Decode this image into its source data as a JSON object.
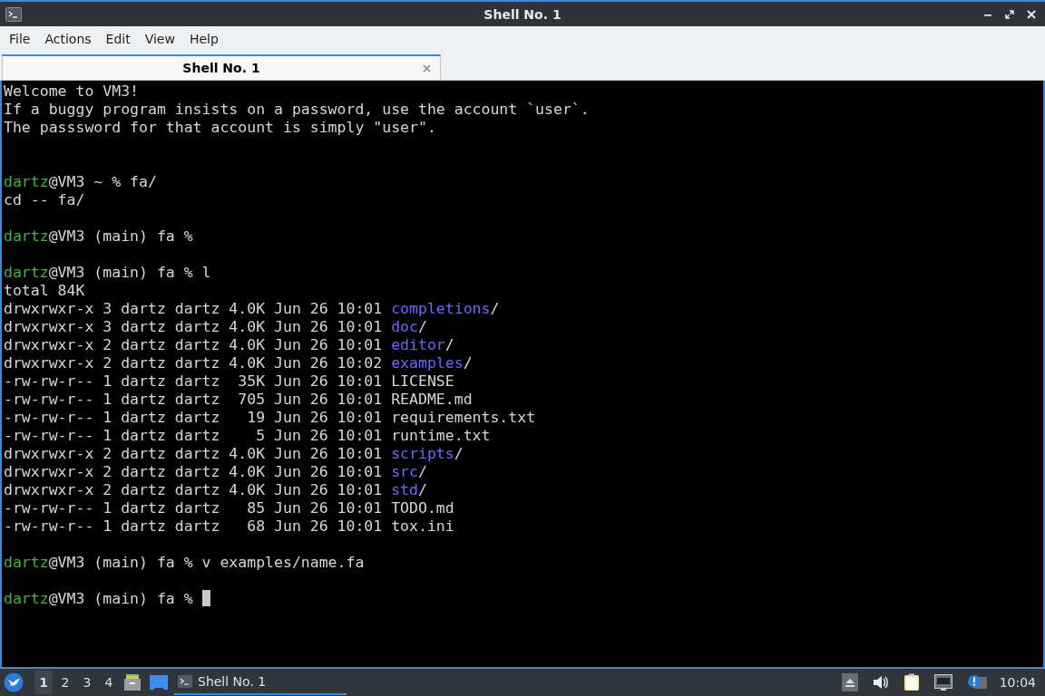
{
  "window": {
    "title": "Shell No. 1"
  },
  "menu": [
    "File",
    "Actions",
    "Edit",
    "View",
    "Help"
  ],
  "tabs": [
    {
      "label": "Shell No. 1",
      "selected": true
    }
  ],
  "terminal": {
    "lines": [
      {
        "segments": [
          {
            "kind": "plain",
            "text": "Welcome to VM3!"
          }
        ]
      },
      {
        "segments": [
          {
            "kind": "plain",
            "text": "If a buggy program insists on a password, use the account `user`."
          }
        ]
      },
      {
        "segments": [
          {
            "kind": "plain",
            "text": "The passsword for that account is simply \"user\"."
          }
        ]
      },
      {
        "kind": "blank"
      },
      {
        "kind": "blank"
      },
      {
        "segments": [
          {
            "kind": "user",
            "text": "dartz"
          },
          {
            "kind": "plain",
            "text": "@VM3 ~ % fa/"
          }
        ]
      },
      {
        "segments": [
          {
            "kind": "plain",
            "text": "cd -- fa/"
          }
        ]
      },
      {
        "kind": "blank"
      },
      {
        "segments": [
          {
            "kind": "user",
            "text": "dartz"
          },
          {
            "kind": "plain",
            "text": "@VM3 (main) fa %"
          }
        ]
      },
      {
        "kind": "blank"
      },
      {
        "segments": [
          {
            "kind": "user",
            "text": "dartz"
          },
          {
            "kind": "plain",
            "text": "@VM3 (main) fa % l"
          }
        ]
      },
      {
        "segments": [
          {
            "kind": "plain",
            "text": "total 84K"
          }
        ]
      },
      {
        "segments": [
          {
            "kind": "plain",
            "text": "drwxrwxr-x 3 dartz dartz 4.0K Jun 26 10:01 "
          },
          {
            "kind": "dir",
            "text": "completions"
          },
          {
            "kind": "plain",
            "text": "/"
          }
        ]
      },
      {
        "segments": [
          {
            "kind": "plain",
            "text": "drwxrwxr-x 3 dartz dartz 4.0K Jun 26 10:01 "
          },
          {
            "kind": "dir",
            "text": "doc"
          },
          {
            "kind": "plain",
            "text": "/"
          }
        ]
      },
      {
        "segments": [
          {
            "kind": "plain",
            "text": "drwxrwxr-x 2 dartz dartz 4.0K Jun 26 10:01 "
          },
          {
            "kind": "dir",
            "text": "editor"
          },
          {
            "kind": "plain",
            "text": "/"
          }
        ]
      },
      {
        "segments": [
          {
            "kind": "plain",
            "text": "drwxrwxr-x 2 dartz dartz 4.0K Jun 26 10:02 "
          },
          {
            "kind": "dir",
            "text": "examples"
          },
          {
            "kind": "plain",
            "text": "/"
          }
        ]
      },
      {
        "segments": [
          {
            "kind": "plain",
            "text": "-rw-rw-r-- 1 dartz dartz  35K Jun 26 10:01 LICENSE"
          }
        ]
      },
      {
        "segments": [
          {
            "kind": "plain",
            "text": "-rw-rw-r-- 1 dartz dartz  705 Jun 26 10:01 README.md"
          }
        ]
      },
      {
        "segments": [
          {
            "kind": "plain",
            "text": "-rw-rw-r-- 1 dartz dartz   19 Jun 26 10:01 requirements.txt"
          }
        ]
      },
      {
        "segments": [
          {
            "kind": "plain",
            "text": "-rw-rw-r-- 1 dartz dartz    5 Jun 26 10:01 runtime.txt"
          }
        ]
      },
      {
        "segments": [
          {
            "kind": "plain",
            "text": "drwxrwxr-x 2 dartz dartz 4.0K Jun 26 10:01 "
          },
          {
            "kind": "dir",
            "text": "scripts"
          },
          {
            "kind": "plain",
            "text": "/"
          }
        ]
      },
      {
        "segments": [
          {
            "kind": "plain",
            "text": "drwxrwxr-x 2 dartz dartz 4.0K Jun 26 10:01 "
          },
          {
            "kind": "dir",
            "text": "src"
          },
          {
            "kind": "plain",
            "text": "/"
          }
        ]
      },
      {
        "segments": [
          {
            "kind": "plain",
            "text": "drwxrwxr-x 2 dartz dartz 4.0K Jun 26 10:01 "
          },
          {
            "kind": "dir",
            "text": "std"
          },
          {
            "kind": "plain",
            "text": "/"
          }
        ]
      },
      {
        "segments": [
          {
            "kind": "plain",
            "text": "-rw-rw-r-- 1 dartz dartz   85 Jun 26 10:01 TODO.md"
          }
        ]
      },
      {
        "segments": [
          {
            "kind": "plain",
            "text": "-rw-rw-r-- 1 dartz dartz   68 Jun 26 10:01 tox.ini"
          }
        ]
      },
      {
        "kind": "blank"
      },
      {
        "segments": [
          {
            "kind": "user",
            "text": "dartz"
          },
          {
            "kind": "plain",
            "text": "@VM3 (main) fa % v examples/name.fa"
          }
        ]
      },
      {
        "kind": "blank"
      },
      {
        "segments": [
          {
            "kind": "user",
            "text": "dartz"
          },
          {
            "kind": "plain",
            "text": "@VM3 (main) fa % "
          },
          {
            "kind": "cursor"
          }
        ]
      }
    ]
  },
  "taskbar": {
    "desktops": [
      {
        "label": "1",
        "selected": true
      },
      {
        "label": "2",
        "selected": false
      },
      {
        "label": "3",
        "selected": false
      },
      {
        "label": "4",
        "selected": false
      }
    ],
    "tasks": [
      {
        "label": "Shell No. 1",
        "selected": true
      }
    ],
    "clock": "10:04"
  }
}
